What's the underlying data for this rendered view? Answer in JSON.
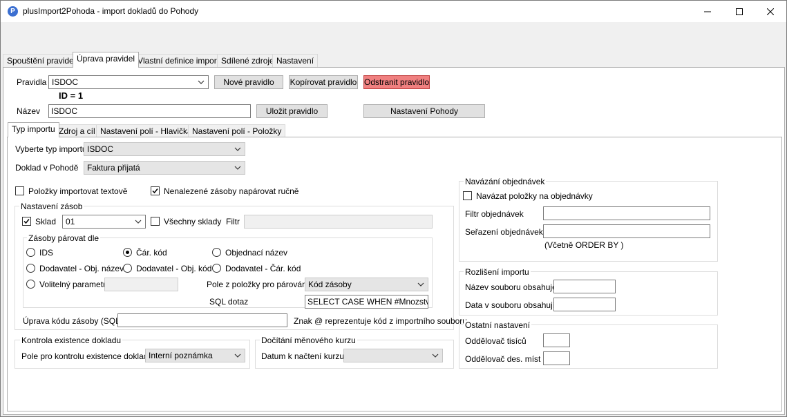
{
  "window": {
    "title": "plusImport2Pohoda - import dokladů do Pohody"
  },
  "main_tabs": [
    "Spouštění pravidel",
    "Úprava pravidel",
    "Vlastní definice importu",
    "Sdílené zdroje",
    "Nastavení"
  ],
  "rules": {
    "pravidla_label": "Pravidla",
    "pravidla_value": "ISDOC",
    "new_rule": "Nové pravidlo",
    "copy_rule": "Kopírovat pravidlo",
    "delete_rule": "Odstranit pravidlo",
    "id_text": "ID = 1",
    "nazev_label": "Název",
    "nazev_value": "ISDOC",
    "save_rule": "Uložit pravidlo",
    "pohoda_settings": "Nastavení Pohody"
  },
  "sub_tabs": [
    "Typ importu",
    "Zdroj a cíl",
    "Nastavení polí - Hlavička",
    "Nastavení polí - Položky"
  ],
  "import_type": {
    "type_label": "Vyberte typ importu",
    "type_value": "ISDOC",
    "doc_label": "Doklad v Pohodě",
    "doc_value": "Faktura přijatá",
    "items_text_label": "Položky importovat textově",
    "manual_match_label": "Nenalezené zásoby napárovat ručně"
  },
  "stock": {
    "group_title": "Nastavení zásob",
    "sklad_label": "Sklad",
    "sklad_value": "01",
    "all_stores_label": "Všechny sklady",
    "filter_label": "Filtr",
    "pair_group_title": "Zásoby párovat dle",
    "radios": [
      "IDS",
      "Čár. kód",
      "Objednací název",
      "Dodavatel - Obj. název",
      "Dodavatel - Obj. kód",
      "Dodavatel - Čár. kód",
      "Volitelný parametr"
    ],
    "pair_field_label": "Pole z položky pro párování",
    "pair_field_value": "Kód zásoby",
    "sql_label": "SQL dotaz",
    "sql_value": "SELECT CASE WHEN #Mnozstvi# <",
    "code_sql_label": "Úprava kódu zásoby (SQL)",
    "code_sql_hint": "Znak @ reprezentuje kód z importního souboru"
  },
  "doc_check": {
    "group_title": "Kontrola existence dokladu",
    "field_label": "Pole pro kontrolu existence dokladu",
    "field_value": "Interní poznámka"
  },
  "currency": {
    "group_title": "Dočítání měnového kurzu",
    "date_label": "Datum k načtení kurzu",
    "date_value": ""
  },
  "orders": {
    "group_title": "Navázání objednávek",
    "link_label": "Navázat položky na objednávky",
    "filter_label": "Filtr objednávek",
    "sort_label": "Seřazení objednávek",
    "sort_hint": "(Včetně ORDER BY )"
  },
  "import_diff": {
    "group_title": "Rozlišení importu",
    "filename_label": "Název souboru obsahuje",
    "data_label": "Data v souboru obsahují"
  },
  "other": {
    "group_title": "Ostatní nastavení",
    "thousands_label": "Oddělovač tisíců",
    "decimal_label": "Oddělovač des. míst"
  }
}
